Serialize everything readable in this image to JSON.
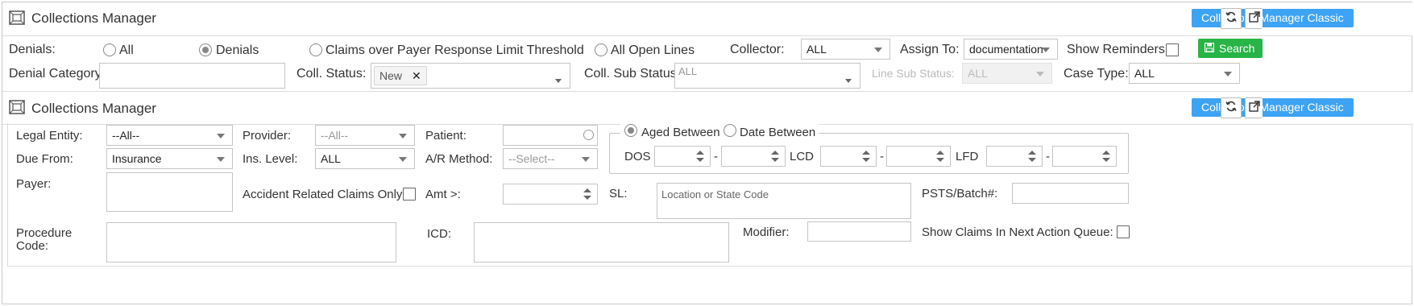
{
  "panel1": {
    "title": "Collections Manager",
    "classic_button": "Collections Manager Classic",
    "icons": [
      "panel-window-icon",
      "refresh-icon",
      "popout-icon"
    ]
  },
  "filters": {
    "denials_label": "Denials:",
    "radio_all": "All",
    "radio_denials": "Denials",
    "radio_claims_over": "Claims over Payer Response Limit Threshold",
    "radio_all_open": "All Open Lines",
    "selected_radio": "Denials",
    "collector_label": "Collector:",
    "collector_value": "ALL",
    "assign_label": "Assign To:",
    "assign_value": "documentation",
    "show_reminders_label": "Show Reminders:",
    "search_label": "Search",
    "denial_category_label": "Denial Category:",
    "coll_status_label": "Coll. Status:",
    "coll_status_tag": "New",
    "coll_sub_status_label": "Coll. Sub Status:",
    "coll_sub_status_value": "ALL",
    "line_sub_status_label": "Line Sub Status:",
    "line_sub_status_value": "ALL",
    "case_type_label": "Case Type:",
    "case_type_value": "ALL"
  },
  "panel2": {
    "title": "Collections Manager",
    "classic_button": "Collections Manager Classic"
  },
  "form": {
    "legal_entity_label": "Legal Entity:",
    "legal_entity_value": "--All--",
    "provider_label": "Provider:",
    "provider_value": "--All--",
    "patient_label": "Patient:",
    "due_from_label": "Due From:",
    "due_from_value": "Insurance",
    "ins_level_label": "Ins. Level:",
    "ins_level_value": "ALL",
    "ar_method_label": "A/R Method:",
    "ar_method_value": "--Select--",
    "payer_label": "Payer:",
    "accident_label": "Accident Related Claims Only:",
    "amt_label": "Amt >:",
    "sl_label": "SL:",
    "sl_placeholder": "Location or State Code",
    "psts_label": "PSTS/Batch#:",
    "procedure_label": "Procedure Code:",
    "icd_label": "ICD:",
    "modifier_label": "Modifier:",
    "show_claims_label": "Show Claims In Next Action Queue:",
    "aged_between": "Aged Between",
    "date_between": "Date Between",
    "date_mode_selected": "Aged Between",
    "dos_label": "DOS",
    "lcd_label": "LCD",
    "lfd_label": "LFD",
    "range_sep": "-"
  }
}
